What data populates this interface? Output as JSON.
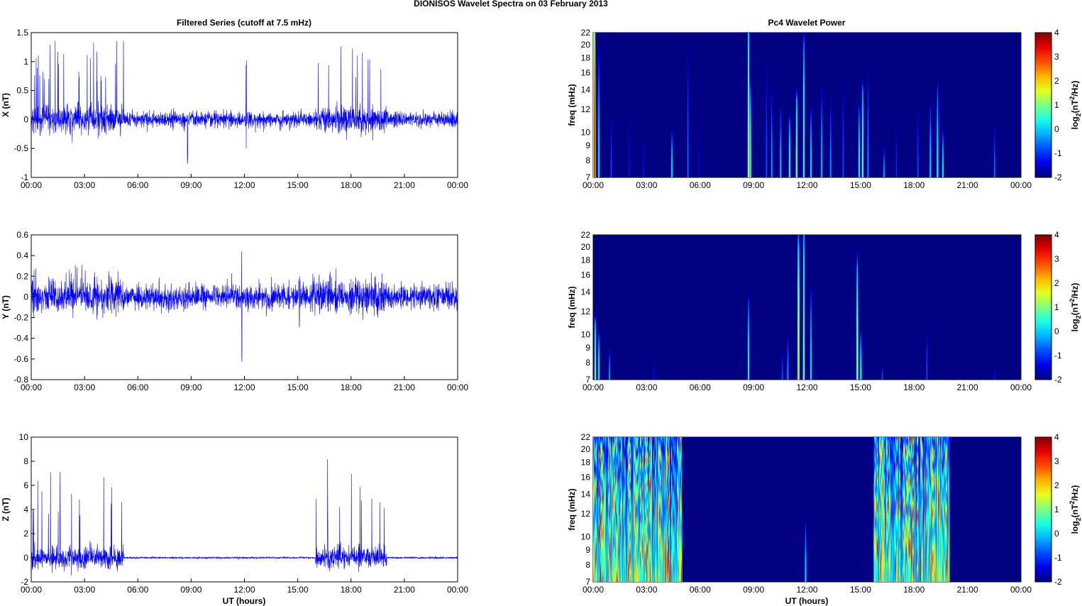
{
  "title": "DIONISOS Wavelet Spectra on 03 February  2013",
  "left_title": "Filtered Series (cutoff at 7.5 mHz)",
  "right_title": "Pc4 Wavelet Power",
  "xlabel": "UT (hours)",
  "freq_label": "freq (mHz)",
  "colorbar_label": {
    "base": "log",
    "sub": "2",
    "mid": "(nT",
    "sup": "2",
    "end": "/Hz)"
  },
  "chart_data": [
    {
      "type": "line",
      "component": "X",
      "ylabel": "X (nT)",
      "xlim_hours": [
        0,
        24
      ],
      "ylim": [
        -1,
        1.5
      ],
      "yticks": [
        "-1",
        "-0.5",
        "0",
        "0.5",
        "1",
        "1.5"
      ],
      "ytick_values": [
        -1,
        -0.5,
        0,
        0.5,
        1,
        1.5
      ],
      "xticks": [
        "00:00",
        "03:00",
        "06:00",
        "09:00",
        "12:00",
        "15:00",
        "18:00",
        "21:00",
        "00:00"
      ],
      "color": "#0000ff",
      "noise_amplitude": 0.07,
      "burst_noise_amplitude": 0.12,
      "spike_bursts": [
        {
          "start_h": 0.0,
          "end_h": 5.2,
          "max": 1.38
        },
        {
          "start_h": 16.0,
          "end_h": 20.0,
          "max": 1.45
        }
      ],
      "events": [
        {
          "t_h": 8.8,
          "min": -0.78,
          "max": 0.6
        },
        {
          "t_h": 12.1,
          "min": -0.55,
          "max": 1.05
        }
      ]
    },
    {
      "type": "line",
      "component": "Y",
      "ylabel": "Y (nT)",
      "xlim_hours": [
        0,
        24
      ],
      "ylim": [
        -0.8,
        0.6
      ],
      "yticks": [
        "-0.8",
        "-0.6",
        "-0.4",
        "-0.2",
        "0",
        "0.2",
        "0.4",
        "0.6"
      ],
      "ytick_values": [
        -0.8,
        -0.6,
        -0.4,
        -0.2,
        0,
        0.2,
        0.4,
        0.6
      ],
      "xticks": [
        "00:00",
        "03:00",
        "06:00",
        "09:00",
        "12:00",
        "15:00",
        "18:00",
        "21:00",
        "00:00"
      ],
      "color": "#0000ff",
      "noise_amplitude": 0.06,
      "burst_noise_amplitude": 0.08,
      "spike_bursts": [
        {
          "start_h": 0.0,
          "end_h": 5.2,
          "max": 0.32
        },
        {
          "start_h": 15.8,
          "end_h": 20.0,
          "max": 0.3
        }
      ],
      "events": [
        {
          "t_h": 11.85,
          "min": -0.63,
          "max": 0.54
        },
        {
          "t_h": 15.1,
          "min": -0.3,
          "max": 0.25
        }
      ]
    },
    {
      "type": "line",
      "component": "Z",
      "ylabel": "Z (nT)",
      "xlim_hours": [
        0,
        24
      ],
      "ylim": [
        -2,
        10
      ],
      "yticks": [
        "-2",
        "0",
        "2",
        "4",
        "6",
        "8",
        "10"
      ],
      "ytick_values": [
        -2,
        0,
        2,
        4,
        6,
        8,
        10
      ],
      "xticks": [
        "00:00",
        "03:00",
        "06:00",
        "09:00",
        "12:00",
        "15:00",
        "18:00",
        "21:00",
        "00:00"
      ],
      "color": "#0000ff",
      "noise_amplitude": 0.04,
      "burst_noise_amplitude": 0.45,
      "spike_bursts": [
        {
          "start_h": 0.0,
          "end_h": 5.2,
          "max": 7.6
        },
        {
          "start_h": 16.0,
          "end_h": 20.0,
          "max": 8.8
        }
      ],
      "events": []
    },
    {
      "type": "heatmap",
      "component": "X",
      "ylabel": "freq (mHz)",
      "yscale": "log",
      "ylim_mHz": [
        7,
        22
      ],
      "yticks": [
        "7",
        "8",
        "9",
        "10",
        "12",
        "14",
        "16",
        "18",
        "20",
        "22"
      ],
      "ytick_values": [
        7,
        8,
        9,
        10,
        12,
        14,
        16,
        18,
        20,
        22
      ],
      "xticks": [
        "00:00",
        "03:00",
        "06:00",
        "09:00",
        "12:00",
        "15:00",
        "18:00",
        "21:00",
        "00:00"
      ],
      "clim": [
        -2,
        4
      ],
      "colorbar_ticks": [
        "-2",
        "-1",
        "0",
        "1",
        "2",
        "3",
        "4"
      ],
      "colormap": "jet",
      "broadband_bursts": [],
      "events": [
        [
          0.05,
          22,
          3.5
        ],
        [
          0.3,
          18,
          0.5
        ],
        [
          1.0,
          12,
          -0.5
        ],
        [
          2.0,
          14,
          -1
        ],
        [
          2.8,
          11,
          -1
        ],
        [
          4.4,
          10,
          0.5
        ],
        [
          5.3,
          20,
          -0.3
        ],
        [
          5.9,
          14,
          -1.2
        ],
        [
          8.7,
          22,
          1.8
        ],
        [
          8.8,
          14,
          1.0
        ],
        [
          9.7,
          20,
          -0.5
        ],
        [
          10.0,
          14,
          0
        ],
        [
          10.5,
          12,
          0.3
        ],
        [
          11.0,
          11,
          1
        ],
        [
          11.4,
          13,
          1.5
        ],
        [
          11.8,
          20,
          1.2
        ],
        [
          12.2,
          12,
          0.5
        ],
        [
          12.8,
          14,
          0.2
        ],
        [
          13.3,
          13,
          0
        ],
        [
          14.0,
          16,
          -0.5
        ],
        [
          14.9,
          12,
          0.8
        ],
        [
          15.1,
          14,
          1.2
        ],
        [
          15.4,
          16,
          0
        ],
        [
          16.3,
          9,
          0
        ],
        [
          17.0,
          12,
          -0.8
        ],
        [
          18.2,
          13,
          -0.5
        ],
        [
          18.9,
          12,
          0.5
        ],
        [
          19.3,
          14,
          0.8
        ],
        [
          19.6,
          10,
          0.6
        ],
        [
          22.5,
          11,
          -0.3
        ]
      ]
    },
    {
      "type": "heatmap",
      "component": "Y",
      "ylabel": "freq (mHz)",
      "yscale": "log",
      "ylim_mHz": [
        7,
        22
      ],
      "yticks": [
        "7",
        "8",
        "9",
        "10",
        "12",
        "14",
        "16",
        "18",
        "20",
        "22"
      ],
      "ytick_values": [
        7,
        8,
        9,
        10,
        12,
        14,
        16,
        18,
        20,
        22
      ],
      "xticks": [
        "00:00",
        "03:00",
        "06:00",
        "09:00",
        "12:00",
        "15:00",
        "18:00",
        "21:00",
        "00:00"
      ],
      "clim": [
        -2,
        4
      ],
      "colorbar_ticks": [
        "-2",
        "-1",
        "0",
        "1",
        "2",
        "3",
        "4"
      ],
      "colormap": "jet",
      "broadband_bursts": [],
      "events": [
        [
          0.1,
          11,
          1.5
        ],
        [
          0.3,
          10,
          0.8
        ],
        [
          0.9,
          9,
          0
        ],
        [
          3.4,
          9,
          -1
        ],
        [
          8.7,
          13,
          0.8
        ],
        [
          10.6,
          9,
          -0.5
        ],
        [
          10.9,
          10,
          0
        ],
        [
          11.5,
          20,
          2
        ],
        [
          11.8,
          22,
          1.5
        ],
        [
          12.2,
          14,
          0.5
        ],
        [
          14.8,
          17,
          1.5
        ],
        [
          15.0,
          10,
          0.8
        ],
        [
          16.2,
          8,
          -0.5
        ],
        [
          18.7,
          11,
          -0.5
        ],
        [
          22.5,
          8,
          -1
        ]
      ]
    },
    {
      "type": "heatmap",
      "component": "Z",
      "ylabel": "freq (mHz)",
      "yscale": "log",
      "ylim_mHz": [
        7,
        22
      ],
      "yticks": [
        "7",
        "8",
        "9",
        "10",
        "12",
        "14",
        "16",
        "18",
        "20",
        "22"
      ],
      "ytick_values": [
        7,
        8,
        9,
        10,
        12,
        14,
        16,
        18,
        20,
        22
      ],
      "xticks": [
        "00:00",
        "03:00",
        "06:00",
        "09:00",
        "12:00",
        "15:00",
        "18:00",
        "21:00",
        "00:00"
      ],
      "clim": [
        -2,
        4
      ],
      "colorbar_ticks": [
        "-2",
        "-1",
        "0",
        "1",
        "2",
        "3",
        "4"
      ],
      "colormap": "jet",
      "broadband_bursts": [
        {
          "start_h": 0.0,
          "end_h": 5.0
        },
        {
          "start_h": 15.7,
          "end_h": 20.0
        }
      ],
      "events": [
        [
          11.9,
          11,
          0.5
        ]
      ]
    }
  ]
}
